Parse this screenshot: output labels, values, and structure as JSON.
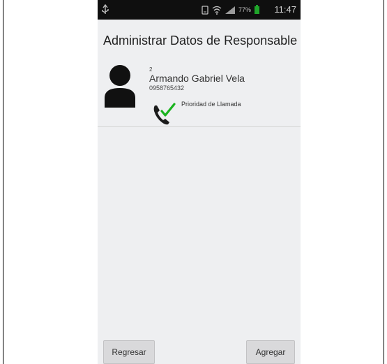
{
  "statusbar": {
    "time": "11:47",
    "battery_pct": "77%"
  },
  "screen": {
    "title": "Administrar Datos de Responsable",
    "contact": {
      "order": "2",
      "name": "Armando Gabriel Vela",
      "phone": "0958765432",
      "priority_label": "Prioridad de Llamada"
    }
  },
  "buttons": {
    "back_label": "Regresar",
    "add_label": "Agregar"
  },
  "colors": {
    "status_bar": "#0f0f0f",
    "background": "#eeeff1",
    "check": "#19b31e",
    "button": "#d9d9db"
  }
}
